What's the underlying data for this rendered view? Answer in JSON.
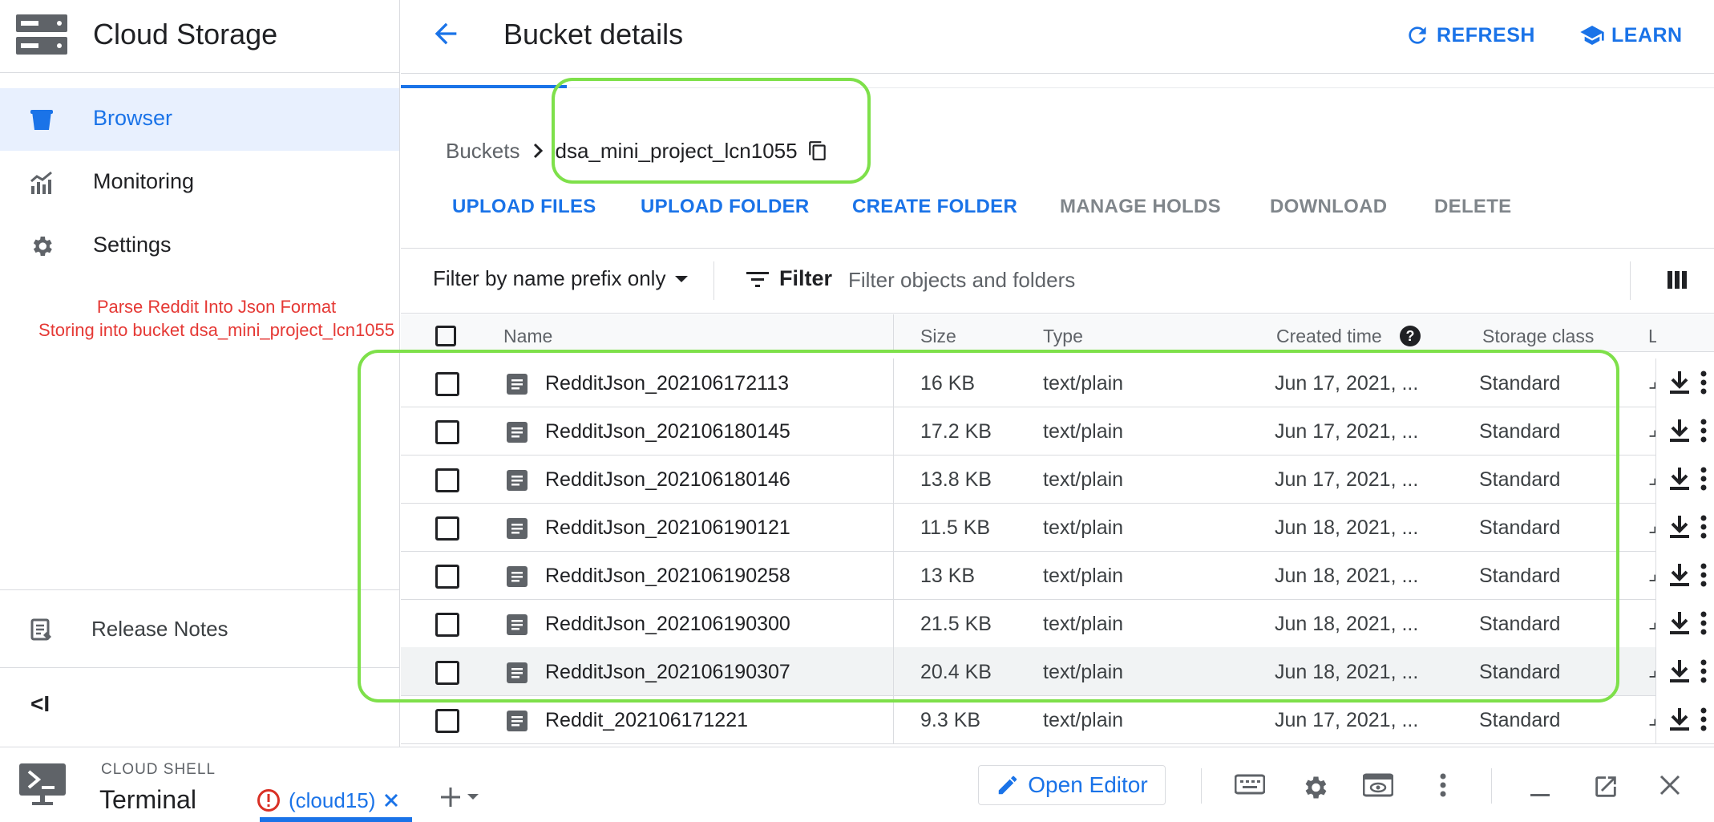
{
  "sidebar": {
    "product_title": "Cloud Storage",
    "items": [
      {
        "label": "Browser",
        "icon": "bucket-icon",
        "active": true
      },
      {
        "label": "Monitoring",
        "icon": "chart-icon",
        "active": false
      },
      {
        "label": "Settings",
        "icon": "gear-icon",
        "active": false
      }
    ],
    "release_notes": "Release Notes",
    "collapse_label": "<I"
  },
  "annotation": {
    "line1": "Parse Reddit Into Json Format",
    "line2": "Storing into bucket dsa_mini_project_lcn1055",
    "color": "#e53935"
  },
  "header": {
    "title": "Bucket details",
    "refresh_label": "REFRESH",
    "learn_label": "LEARN"
  },
  "breadcrumb": {
    "root": "Buckets",
    "bucket": "dsa_mini_project_lcn1055"
  },
  "actions": {
    "upload_files": "UPLOAD FILES",
    "upload_folder": "UPLOAD FOLDER",
    "create_folder": "CREATE FOLDER",
    "manage_holds": "MANAGE HOLDS",
    "download": "DOWNLOAD",
    "delete": "DELETE"
  },
  "filter": {
    "mode": "Filter by name prefix only",
    "button_label": "Filter",
    "placeholder": "Filter objects and folders"
  },
  "table": {
    "columns": {
      "name": "Name",
      "size": "Size",
      "type": "Type",
      "created": "Created time",
      "storage_class": "Storage class",
      "truncated": "L"
    },
    "rows": [
      {
        "name": "RedditJson_202106172113",
        "size": "16 KB",
        "type": "text/plain",
        "created": "Jun 17, 2021, ...",
        "storage_class": "Standard"
      },
      {
        "name": "RedditJson_202106180145",
        "size": "17.2 KB",
        "type": "text/plain",
        "created": "Jun 17, 2021, ...",
        "storage_class": "Standard"
      },
      {
        "name": "RedditJson_202106180146",
        "size": "13.8 KB",
        "type": "text/plain",
        "created": "Jun 17, 2021, ...",
        "storage_class": "Standard"
      },
      {
        "name": "RedditJson_202106190121",
        "size": "11.5 KB",
        "type": "text/plain",
        "created": "Jun 18, 2021, ...",
        "storage_class": "Standard"
      },
      {
        "name": "RedditJson_202106190258",
        "size": "13 KB",
        "type": "text/plain",
        "created": "Jun 18, 2021, ...",
        "storage_class": "Standard"
      },
      {
        "name": "RedditJson_202106190300",
        "size": "21.5 KB",
        "type": "text/plain",
        "created": "Jun 18, 2021, ...",
        "storage_class": "Standard"
      },
      {
        "name": "RedditJson_202106190307",
        "size": "20.4 KB",
        "type": "text/plain",
        "created": "Jun 18, 2021, ...",
        "storage_class": "Standard"
      },
      {
        "name": "Reddit_202106171221",
        "size": "9.3 KB",
        "type": "text/plain",
        "created": "Jun 17, 2021, ...",
        "storage_class": "Standard"
      }
    ]
  },
  "cloud_shell": {
    "section_label": "CLOUD SHELL",
    "title": "Terminal",
    "tab_label": "(cloud15)",
    "open_editor_label": "Open Editor"
  },
  "colors": {
    "accent": "#1a73e8",
    "highlight": "#7ee04a",
    "annotation": "#e53935"
  }
}
